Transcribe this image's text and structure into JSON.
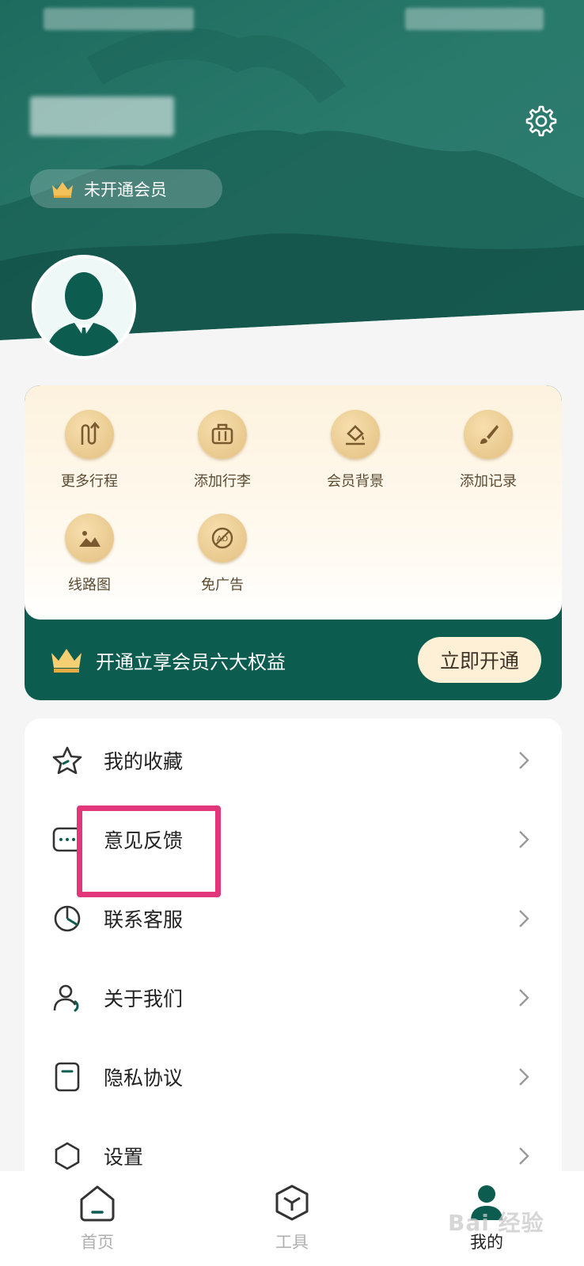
{
  "header": {
    "username": "",
    "vip_status": "未开通会员"
  },
  "member_card": {
    "features": [
      {
        "label": "更多行程",
        "icon": "route-icon"
      },
      {
        "label": "添加行李",
        "icon": "luggage-icon"
      },
      {
        "label": "会员背景",
        "icon": "paint-bucket-icon"
      },
      {
        "label": "添加记录",
        "icon": "brush-icon"
      },
      {
        "label": "线路图",
        "icon": "image-icon"
      },
      {
        "label": "免广告",
        "icon": "no-ad-icon"
      }
    ],
    "promo_text": "开通立享会员六大权益",
    "open_button": "立即开通"
  },
  "menu": {
    "items": [
      {
        "label": "我的收藏",
        "icon": "star-icon"
      },
      {
        "label": "意见反馈",
        "icon": "chat-icon"
      },
      {
        "label": "联系客服",
        "icon": "pie-icon"
      },
      {
        "label": "关于我们",
        "icon": "user-icon"
      },
      {
        "label": "隐私协议",
        "icon": "document-icon"
      },
      {
        "label": "设置",
        "icon": "settings-icon"
      }
    ]
  },
  "tabbar": {
    "tabs": [
      {
        "label": "首页",
        "icon": "home-icon",
        "active": false
      },
      {
        "label": "工具",
        "icon": "cube-icon",
        "active": false
      },
      {
        "label": "我的",
        "icon": "profile-icon",
        "active": true
      }
    ]
  },
  "colors": {
    "brand_green": "#0c5c50",
    "gold": "#e2bf80",
    "highlight": "#e2367a"
  },
  "watermark": "Bai 经验"
}
